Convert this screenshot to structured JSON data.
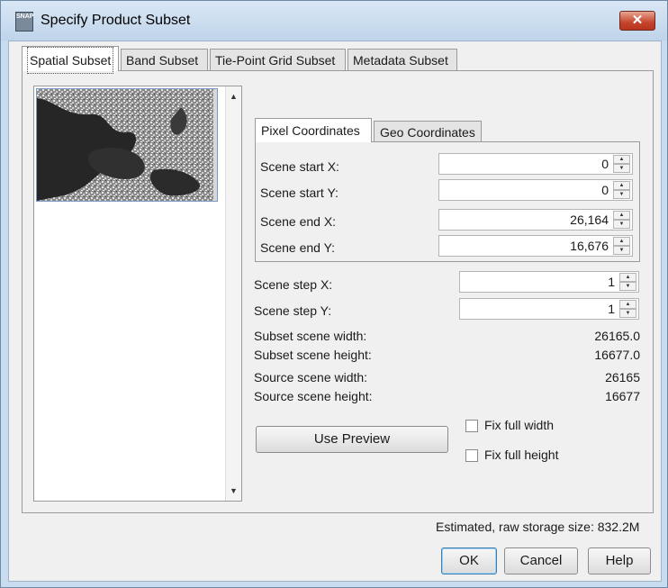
{
  "window": {
    "title": "Specify Product Subset",
    "close_glyph": "✕",
    "app_icon_text": "SNAP"
  },
  "tabs": [
    "Spatial Subset",
    "Band Subset",
    "Tie-Point Grid Subset",
    "Metadata Subset"
  ],
  "coord_tabs": [
    "Pixel Coordinates",
    "Geo Coordinates"
  ],
  "pixel_fields": [
    {
      "label": "Scene start X:",
      "value": "0"
    },
    {
      "label": "Scene start Y:",
      "value": "0"
    },
    {
      "label": "Scene end X:",
      "value": "26,164"
    },
    {
      "label": "Scene end Y:",
      "value": "16,676"
    }
  ],
  "step_fields": [
    {
      "label": "Scene step X:",
      "value": "1"
    },
    {
      "label": "Scene step Y:",
      "value": "1"
    }
  ],
  "info": [
    {
      "label": "Subset scene width:",
      "value": "26165.0"
    },
    {
      "label": "Subset scene height:",
      "value": "16677.0"
    },
    {
      "label": "Source scene width:",
      "value": "26165"
    },
    {
      "label": "Source scene height:",
      "value": "16677"
    }
  ],
  "use_preview_label": "Use Preview",
  "checkboxes": {
    "fix_width": "Fix full width",
    "fix_height": "Fix full height"
  },
  "storage_text": "Estimated, raw storage size: 832.2M",
  "buttons": {
    "ok": "OK",
    "cancel": "Cancel",
    "help": "Help"
  },
  "icons": {
    "scroll_up": "▲",
    "scroll_down": "▼",
    "spin_up": "▲",
    "spin_down": "▼"
  }
}
